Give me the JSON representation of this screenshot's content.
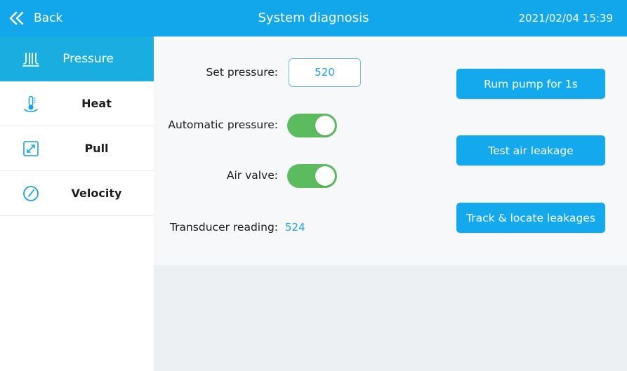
{
  "header": {
    "back_label": "Back",
    "title": "System diagnosis",
    "datetime": "2021/02/04  15:39",
    "color": "#11a7ea"
  },
  "sidebar": {
    "items": [
      {
        "label": "Pressure",
        "icon": "pressure-icon",
        "active": true
      },
      {
        "label": "Heat",
        "icon": "thermometer-icon",
        "active": false
      },
      {
        "label": "Pull",
        "icon": "expand-icon",
        "active": false
      },
      {
        "label": "Velocity",
        "icon": "gauge-icon",
        "active": false
      }
    ]
  },
  "main": {
    "set_pressure_label": "Set pressure:",
    "set_pressure_value": "520",
    "automatic_pressure_label": "Automatic pressure:",
    "automatic_pressure_on": true,
    "air_valve_label": "Air valve:",
    "air_valve_on": true,
    "transducer_label": "Transducer reading:",
    "transducer_value": "524",
    "buttons": {
      "run_pump": "Rum pump for 1s",
      "test_leak": "Test air leakage",
      "track_leak": "Track & locate leakages"
    }
  },
  "colors": {
    "accent": "#14a8ec",
    "active_nav": "#1aaee0",
    "toggle_on": "#5cbb5e",
    "value_text": "#1a9fe0"
  }
}
